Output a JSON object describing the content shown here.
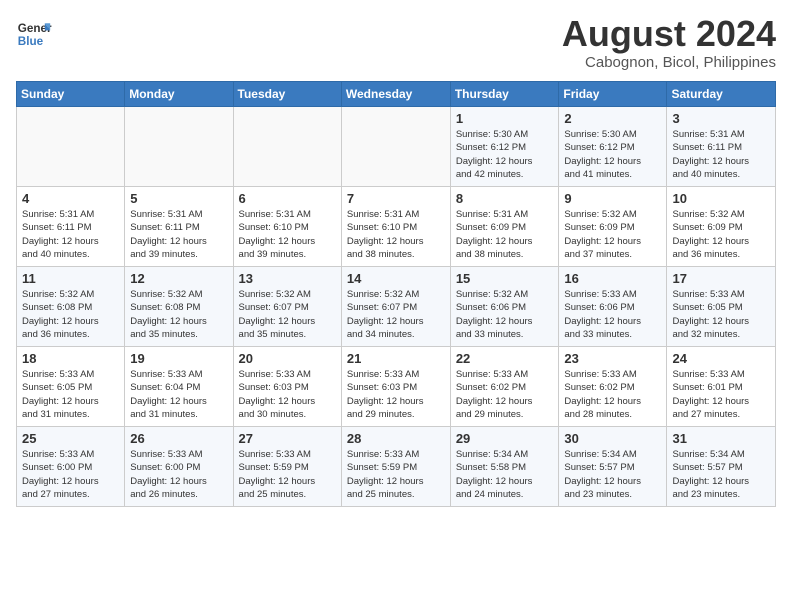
{
  "logo": {
    "line1": "General",
    "line2": "Blue"
  },
  "title": "August 2024",
  "subtitle": "Cabognon, Bicol, Philippines",
  "weekdays": [
    "Sunday",
    "Monday",
    "Tuesday",
    "Wednesday",
    "Thursday",
    "Friday",
    "Saturday"
  ],
  "weeks": [
    [
      {
        "day": "",
        "info": ""
      },
      {
        "day": "",
        "info": ""
      },
      {
        "day": "",
        "info": ""
      },
      {
        "day": "",
        "info": ""
      },
      {
        "day": "1",
        "info": "Sunrise: 5:30 AM\nSunset: 6:12 PM\nDaylight: 12 hours\nand 42 minutes."
      },
      {
        "day": "2",
        "info": "Sunrise: 5:30 AM\nSunset: 6:12 PM\nDaylight: 12 hours\nand 41 minutes."
      },
      {
        "day": "3",
        "info": "Sunrise: 5:31 AM\nSunset: 6:11 PM\nDaylight: 12 hours\nand 40 minutes."
      }
    ],
    [
      {
        "day": "4",
        "info": "Sunrise: 5:31 AM\nSunset: 6:11 PM\nDaylight: 12 hours\nand 40 minutes."
      },
      {
        "day": "5",
        "info": "Sunrise: 5:31 AM\nSunset: 6:11 PM\nDaylight: 12 hours\nand 39 minutes."
      },
      {
        "day": "6",
        "info": "Sunrise: 5:31 AM\nSunset: 6:10 PM\nDaylight: 12 hours\nand 39 minutes."
      },
      {
        "day": "7",
        "info": "Sunrise: 5:31 AM\nSunset: 6:10 PM\nDaylight: 12 hours\nand 38 minutes."
      },
      {
        "day": "8",
        "info": "Sunrise: 5:31 AM\nSunset: 6:09 PM\nDaylight: 12 hours\nand 38 minutes."
      },
      {
        "day": "9",
        "info": "Sunrise: 5:32 AM\nSunset: 6:09 PM\nDaylight: 12 hours\nand 37 minutes."
      },
      {
        "day": "10",
        "info": "Sunrise: 5:32 AM\nSunset: 6:09 PM\nDaylight: 12 hours\nand 36 minutes."
      }
    ],
    [
      {
        "day": "11",
        "info": "Sunrise: 5:32 AM\nSunset: 6:08 PM\nDaylight: 12 hours\nand 36 minutes."
      },
      {
        "day": "12",
        "info": "Sunrise: 5:32 AM\nSunset: 6:08 PM\nDaylight: 12 hours\nand 35 minutes."
      },
      {
        "day": "13",
        "info": "Sunrise: 5:32 AM\nSunset: 6:07 PM\nDaylight: 12 hours\nand 35 minutes."
      },
      {
        "day": "14",
        "info": "Sunrise: 5:32 AM\nSunset: 6:07 PM\nDaylight: 12 hours\nand 34 minutes."
      },
      {
        "day": "15",
        "info": "Sunrise: 5:32 AM\nSunset: 6:06 PM\nDaylight: 12 hours\nand 33 minutes."
      },
      {
        "day": "16",
        "info": "Sunrise: 5:33 AM\nSunset: 6:06 PM\nDaylight: 12 hours\nand 33 minutes."
      },
      {
        "day": "17",
        "info": "Sunrise: 5:33 AM\nSunset: 6:05 PM\nDaylight: 12 hours\nand 32 minutes."
      }
    ],
    [
      {
        "day": "18",
        "info": "Sunrise: 5:33 AM\nSunset: 6:05 PM\nDaylight: 12 hours\nand 31 minutes."
      },
      {
        "day": "19",
        "info": "Sunrise: 5:33 AM\nSunset: 6:04 PM\nDaylight: 12 hours\nand 31 minutes."
      },
      {
        "day": "20",
        "info": "Sunrise: 5:33 AM\nSunset: 6:03 PM\nDaylight: 12 hours\nand 30 minutes."
      },
      {
        "day": "21",
        "info": "Sunrise: 5:33 AM\nSunset: 6:03 PM\nDaylight: 12 hours\nand 29 minutes."
      },
      {
        "day": "22",
        "info": "Sunrise: 5:33 AM\nSunset: 6:02 PM\nDaylight: 12 hours\nand 29 minutes."
      },
      {
        "day": "23",
        "info": "Sunrise: 5:33 AM\nSunset: 6:02 PM\nDaylight: 12 hours\nand 28 minutes."
      },
      {
        "day": "24",
        "info": "Sunrise: 5:33 AM\nSunset: 6:01 PM\nDaylight: 12 hours\nand 27 minutes."
      }
    ],
    [
      {
        "day": "25",
        "info": "Sunrise: 5:33 AM\nSunset: 6:00 PM\nDaylight: 12 hours\nand 27 minutes."
      },
      {
        "day": "26",
        "info": "Sunrise: 5:33 AM\nSunset: 6:00 PM\nDaylight: 12 hours\nand 26 minutes."
      },
      {
        "day": "27",
        "info": "Sunrise: 5:33 AM\nSunset: 5:59 PM\nDaylight: 12 hours\nand 25 minutes."
      },
      {
        "day": "28",
        "info": "Sunrise: 5:33 AM\nSunset: 5:59 PM\nDaylight: 12 hours\nand 25 minutes."
      },
      {
        "day": "29",
        "info": "Sunrise: 5:34 AM\nSunset: 5:58 PM\nDaylight: 12 hours\nand 24 minutes."
      },
      {
        "day": "30",
        "info": "Sunrise: 5:34 AM\nSunset: 5:57 PM\nDaylight: 12 hours\nand 23 minutes."
      },
      {
        "day": "31",
        "info": "Sunrise: 5:34 AM\nSunset: 5:57 PM\nDaylight: 12 hours\nand 23 minutes."
      }
    ]
  ]
}
